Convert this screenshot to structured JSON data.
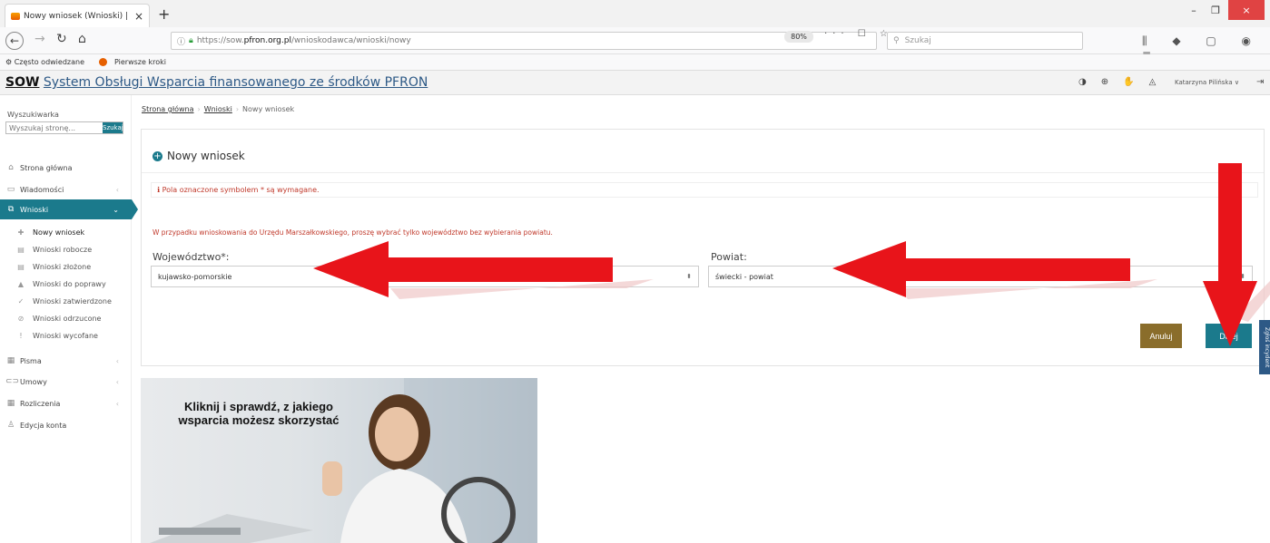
{
  "browser": {
    "tab_title": "Nowy wniosek (Wnioski) | SOW",
    "url_prefix": "https://sow.",
    "url_domain": "pfron.org.pl",
    "url_path": "/wnioskodawca/wnioski/nowy",
    "zoom": "80%",
    "search_placeholder": "Szukaj",
    "bookmarks": [
      "Często odwiedzane",
      "Pierwsze kroki"
    ]
  },
  "app": {
    "brand_short": "SOW",
    "brand_full": "System Obsługi Wsparcia finansowanego ze środków PFRON",
    "user_name": "Katarzyna Pilińska"
  },
  "sidebar": {
    "search_label": "Wyszukiwarka",
    "search_placeholder": "Wyszukaj stronę...",
    "search_button": "Szukaj",
    "items": [
      {
        "label": "Strona główna"
      },
      {
        "label": "Wiadomości"
      },
      {
        "label": "Wnioski"
      },
      {
        "label": "Pisma"
      },
      {
        "label": "Umowy"
      },
      {
        "label": "Rozliczenia"
      },
      {
        "label": "Edycja konta"
      }
    ],
    "subitems": [
      {
        "label": "Nowy wniosek"
      },
      {
        "label": "Wnioski robocze"
      },
      {
        "label": "Wnioski złożone"
      },
      {
        "label": "Wnioski do poprawy"
      },
      {
        "label": "Wnioski zatwierdzone"
      },
      {
        "label": "Wnioski odrzucone"
      },
      {
        "label": "Wnioski wycofane"
      }
    ]
  },
  "breadcrumb": {
    "home": "Strona główna",
    "section": "Wnioski",
    "current": "Nowy wniosek"
  },
  "form": {
    "title": "Nowy wniosek",
    "required_note": "Pola oznaczone symbolem * są wymagane.",
    "hint": "W przypadku wnioskowania do Urzędu Marszałkowskiego, proszę wybrać tylko województwo bez wybierania powiatu.",
    "voivodeship_label": "Województwo*:",
    "voivodeship_value": "kujawsko-pomorskie",
    "county_label": "Powiat:",
    "county_value": "świecki - powiat",
    "cancel_label": "Anuluj",
    "next_label": "Dalej",
    "side_tab": "Zgłoś incydent"
  },
  "banner": {
    "line1": "Kliknij i sprawdź, z jakiego",
    "line2": "wsparcia możesz skorzystać"
  },
  "colors": {
    "accent": "#1b7a8c",
    "cancel": "#8a6d2b",
    "arrow": "#e8141a",
    "error": "#c0392b"
  }
}
